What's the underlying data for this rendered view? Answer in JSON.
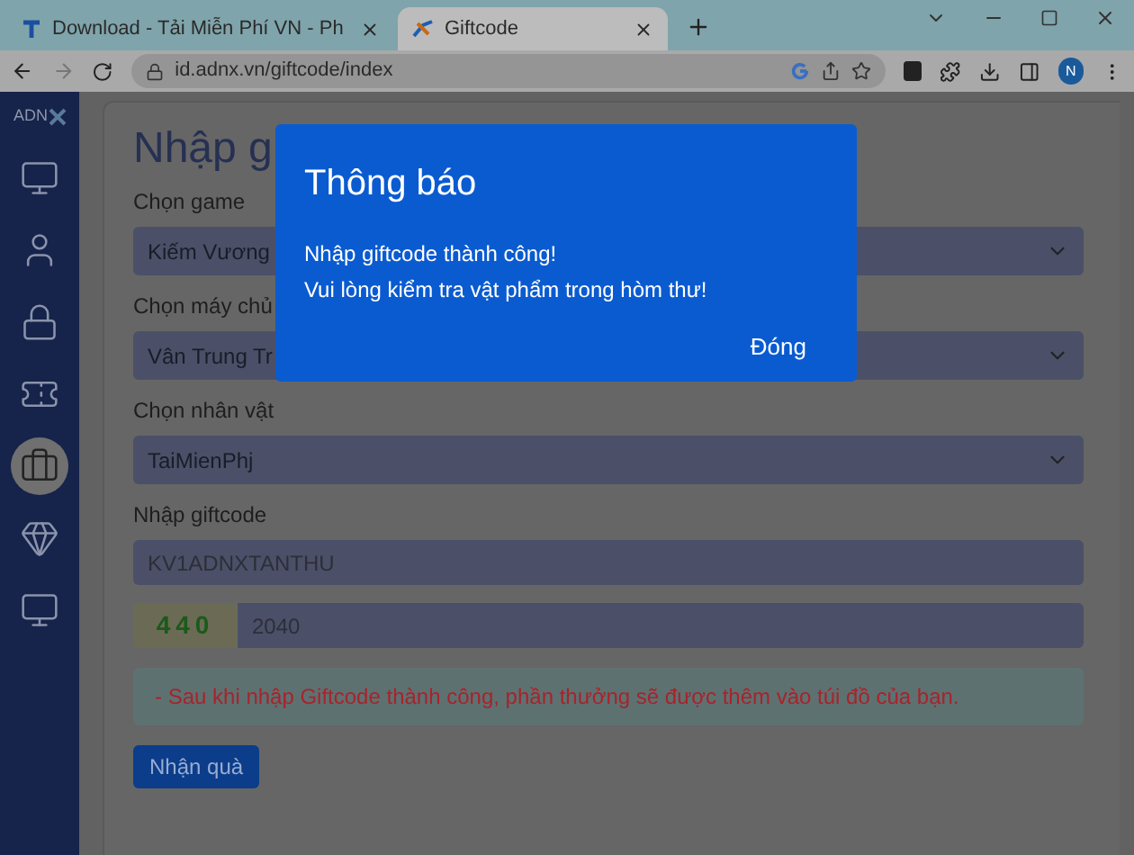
{
  "browser": {
    "tabs": [
      {
        "title": "Download - Tải Miễn Phí VN - Ph",
        "selected": false
      },
      {
        "title": "Giftcode",
        "selected": true
      }
    ],
    "address": "id.adnx.vn/giftcode/index",
    "profile_initial": "N"
  },
  "sidebar": {
    "logo": "ADN",
    "items": [
      {
        "selected": false
      },
      {
        "selected": false
      },
      {
        "selected": false
      },
      {
        "selected": false
      },
      {
        "selected": true
      },
      {
        "selected": false
      },
      {
        "selected": false
      }
    ]
  },
  "page": {
    "title": "Nhập g",
    "fields": [
      {
        "kind": "select",
        "label": "Chọn game",
        "value": "Kiếm Vương"
      },
      {
        "kind": "select",
        "label": "Chọn máy chủ",
        "value": "Vân Trung Tr"
      },
      {
        "kind": "select",
        "label": "Chọn nhân vật",
        "value": "TaiMienPhj"
      },
      {
        "kind": "input",
        "label": "Nhập giftcode",
        "value": "KV1ADNXTANTHU"
      }
    ],
    "captcha": {
      "code": "440",
      "value": "2040"
    },
    "notice": "- Sau khi nhập Giftcode thành công, phần thưởng sẽ được thêm vào túi đồ của bạn.",
    "button": "Nhận quà"
  },
  "dialog": {
    "title": "Thông báo",
    "lines": [
      "Nhập giftcode thành công!",
      "Vui lòng kiểm tra vật phẩm trong hòm thư!"
    ],
    "button": "Đóng"
  }
}
